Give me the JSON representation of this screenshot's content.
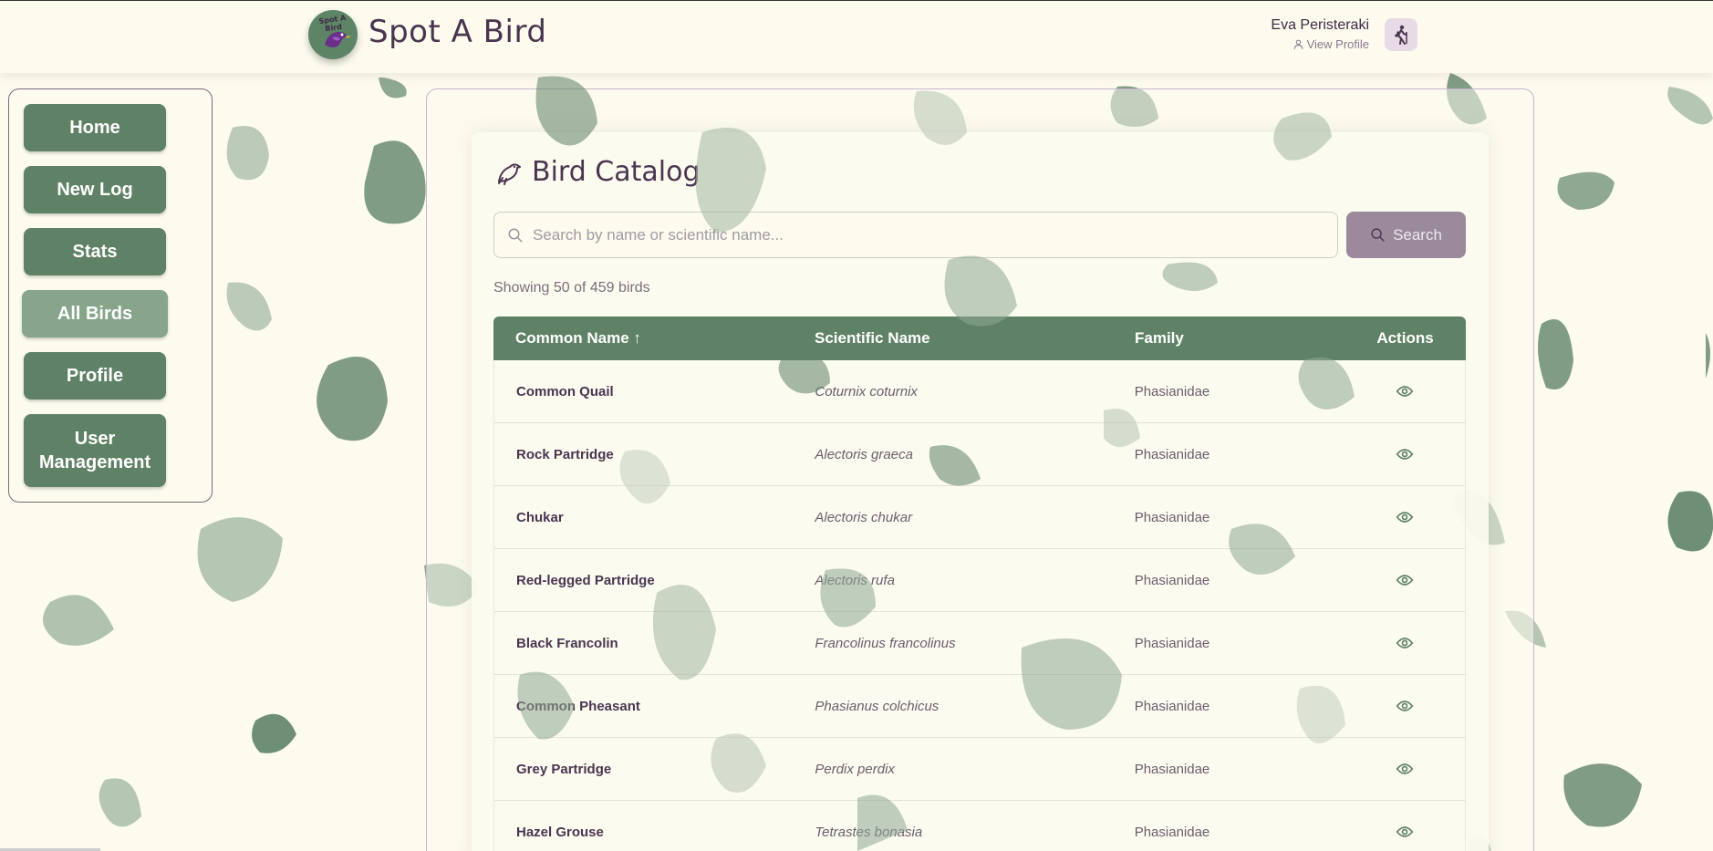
{
  "header": {
    "app_title": "Spot A Bird",
    "logo_text": "Spot A Bird",
    "user_name": "Eva Peristeraki",
    "view_profile": "View Profile"
  },
  "sidebar": {
    "items": [
      {
        "label": "Home",
        "active": false
      },
      {
        "label": "New Log",
        "active": false
      },
      {
        "label": "Stats",
        "active": false
      },
      {
        "label": "All Birds",
        "active": true
      },
      {
        "label": "Profile",
        "active": false
      },
      {
        "label": "User Management",
        "active": false
      }
    ]
  },
  "catalog": {
    "title": "Bird Catalog",
    "search_placeholder": "Search by name or scientific name...",
    "search_button": "Search",
    "showing_text": "Showing 50 of 459 birds",
    "columns": {
      "common_name": "Common Name ↑",
      "scientific_name": "Scientific Name",
      "family": "Family",
      "actions": "Actions"
    },
    "rows": [
      {
        "common": "Common Quail",
        "scientific": "Coturnix coturnix",
        "family": "Phasianidae"
      },
      {
        "common": "Rock Partridge",
        "scientific": "Alectoris graeca",
        "family": "Phasianidae"
      },
      {
        "common": "Chukar",
        "scientific": "Alectoris chukar",
        "family": "Phasianidae"
      },
      {
        "common": "Red-legged Partridge",
        "scientific": "Alectoris rufa",
        "family": "Phasianidae"
      },
      {
        "common": "Black Francolin",
        "scientific": "Francolinus francolinus",
        "family": "Phasianidae"
      },
      {
        "common": "Common Pheasant",
        "scientific": "Phasianus colchicus",
        "family": "Phasianidae"
      },
      {
        "common": "Grey Partridge",
        "scientific": "Perdix perdix",
        "family": "Phasianidae"
      },
      {
        "common": "Hazel Grouse",
        "scientific": "Tetrastes bonasia",
        "family": "Phasianidae"
      }
    ]
  },
  "colors": {
    "background": "#fcfbee",
    "primary_green": "#5f8266",
    "active_green": "#86a58b",
    "accent_purple": "#4a3550",
    "search_button": "#9a8a9c"
  },
  "icons": {
    "catalog": "bird-icon",
    "search": "search-icon",
    "row_action": "eye-icon",
    "view_profile": "user-icon",
    "avatar": "hiker-icon"
  }
}
